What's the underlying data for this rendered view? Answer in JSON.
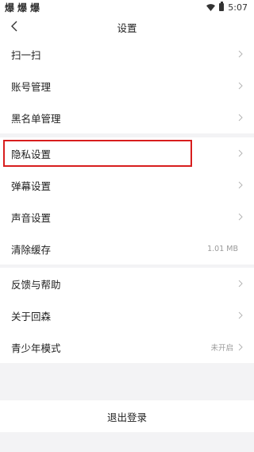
{
  "status_bar": {
    "app_icons": [
      "爆",
      "爆",
      "爆"
    ],
    "time": "5:07"
  },
  "header": {
    "title": "设置"
  },
  "groups": [
    {
      "items": [
        {
          "label": "扫一扫",
          "value": ""
        },
        {
          "label": "账号管理",
          "value": ""
        },
        {
          "label": "黑名单管理",
          "value": ""
        }
      ]
    },
    {
      "items": [
        {
          "label": "隐私设置",
          "value": ""
        },
        {
          "label": "弹幕设置",
          "value": ""
        },
        {
          "label": "声音设置",
          "value": ""
        },
        {
          "label": "清除缓存",
          "value": "1.01 MB"
        }
      ]
    },
    {
      "items": [
        {
          "label": "反馈与帮助",
          "value": ""
        },
        {
          "label": "关于回森",
          "value": ""
        },
        {
          "label": "青少年模式",
          "value": "未开启"
        }
      ]
    }
  ],
  "logout_label": "退出登录",
  "colors": {
    "highlight": "#d81e1e",
    "background": "#f3f3f5"
  }
}
